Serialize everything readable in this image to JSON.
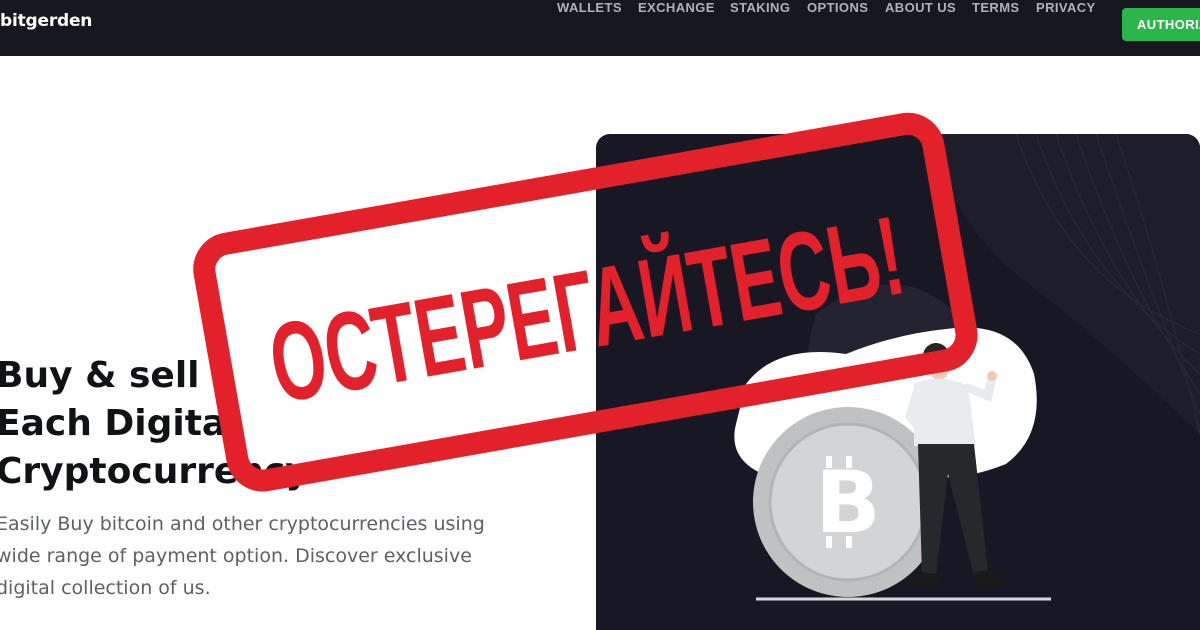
{
  "header": {
    "brand": "bitgerden",
    "nav": [
      "WALLETS",
      "EXCHANGE",
      "STAKING",
      "OPTIONS",
      "ABOUT US",
      "TERMS",
      "PRIVACY"
    ],
    "auth_label": "AUTHORIZ",
    "accent": "#2cb54a"
  },
  "hero": {
    "title_lines": [
      "Buy & sell",
      "Each Digital",
      "Cryptocurrency"
    ],
    "description": "Easily Buy bitcoin and other cryptocurrencies using wide range of payment option. Discover exclusive digital collection of us."
  },
  "illustration": {
    "icon": "bitcoin-coin-icon",
    "coin_symbol": "B"
  },
  "stamp": {
    "text": "ОСТЕРЕГАЙТЕСЬ!",
    "color": "#e3212b"
  }
}
